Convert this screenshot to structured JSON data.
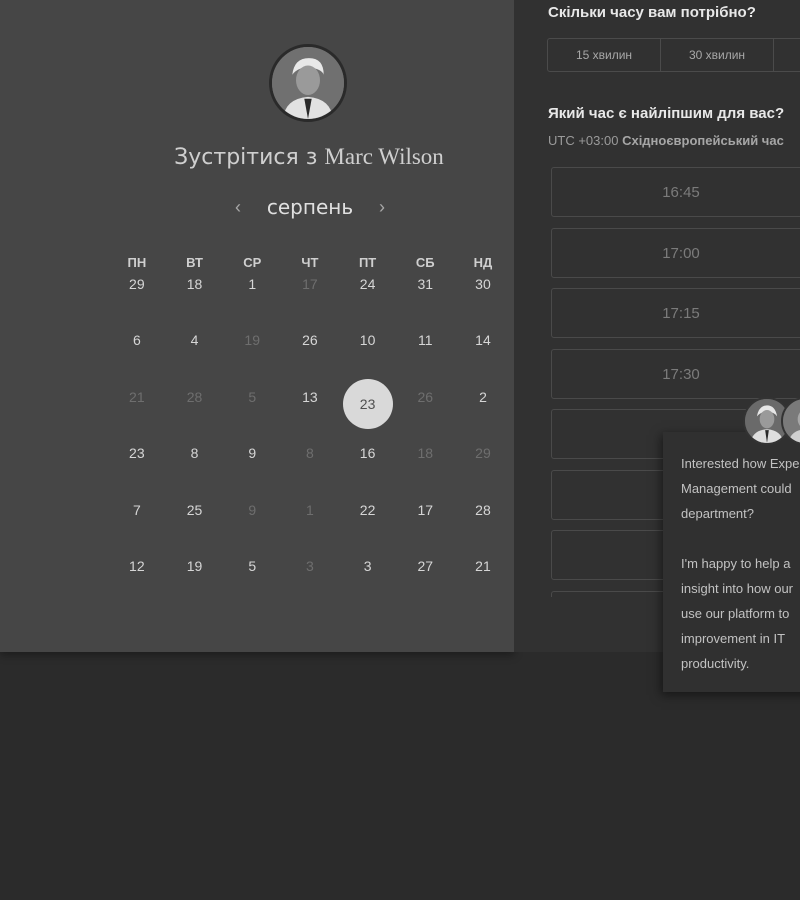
{
  "scheduler": {
    "title_prefix": "Зустрітися з",
    "host_name": "Marc Wilson",
    "month": "серпень",
    "prev_icon": "‹",
    "next_icon": "›",
    "weekdays": [
      "ПН",
      "ВТ",
      "СР",
      "ЧТ",
      "ПТ",
      "СБ",
      "НД"
    ],
    "weeks": [
      [
        {
          "d": "29",
          "m": false
        },
        {
          "d": "18",
          "m": false
        },
        {
          "d": "1",
          "m": false
        },
        {
          "d": "17",
          "m": true
        },
        {
          "d": "24",
          "m": false
        },
        {
          "d": "31",
          "m": false
        },
        {
          "d": "30",
          "m": false
        }
      ],
      [
        {
          "d": "6",
          "m": false
        },
        {
          "d": "4",
          "m": false
        },
        {
          "d": "19",
          "m": true
        },
        {
          "d": "26",
          "m": false
        },
        {
          "d": "10",
          "m": false
        },
        {
          "d": "11",
          "m": false
        },
        {
          "d": "14",
          "m": false
        }
      ],
      [
        {
          "d": "21",
          "m": true
        },
        {
          "d": "28",
          "m": true
        },
        {
          "d": "5",
          "m": true
        },
        {
          "d": "13",
          "m": false
        },
        {
          "d": "23",
          "m": false,
          "selected": true
        },
        {
          "d": "26",
          "m": true
        },
        {
          "d": "2",
          "m": false
        }
      ],
      [
        {
          "d": "23",
          "m": false
        },
        {
          "d": "8",
          "m": false
        },
        {
          "d": "9",
          "m": false
        },
        {
          "d": "8",
          "m": true
        },
        {
          "d": "16",
          "m": false
        },
        {
          "d": "18",
          "m": true
        },
        {
          "d": "29",
          "m": true
        }
      ],
      [
        {
          "d": "7",
          "m": false
        },
        {
          "d": "25",
          "m": false
        },
        {
          "d": "9",
          "m": true
        },
        {
          "d": "1",
          "m": true
        },
        {
          "d": "22",
          "m": false
        },
        {
          "d": "17",
          "m": false
        },
        {
          "d": "28",
          "m": false
        }
      ],
      [
        {
          "d": "12",
          "m": false
        },
        {
          "d": "19",
          "m": false
        },
        {
          "d": "5",
          "m": false
        },
        {
          "d": "3",
          "m": true
        },
        {
          "d": "3",
          "m": false
        },
        {
          "d": "27",
          "m": false
        },
        {
          "d": "21",
          "m": false
        }
      ]
    ]
  },
  "booking": {
    "duration_question": "Скільки часу вам потрібно?",
    "durations": [
      "15 хвилин",
      "30 хвилин"
    ],
    "time_question": "Який час є найліпшим для вас?",
    "tz_offset": "UTC +03:00",
    "tz_name": "Східноєвропейський час",
    "slots": [
      "16:45",
      "17:00",
      "17:15",
      "17:30",
      "",
      "",
      "",
      ""
    ]
  },
  "chat": {
    "message_1": "Interested how Expert\nManagement could\ndepartment?",
    "message_2": "I'm happy to help a\ninsight into how our\nuse our platform to\nimprovement in IT\nproductivity."
  }
}
